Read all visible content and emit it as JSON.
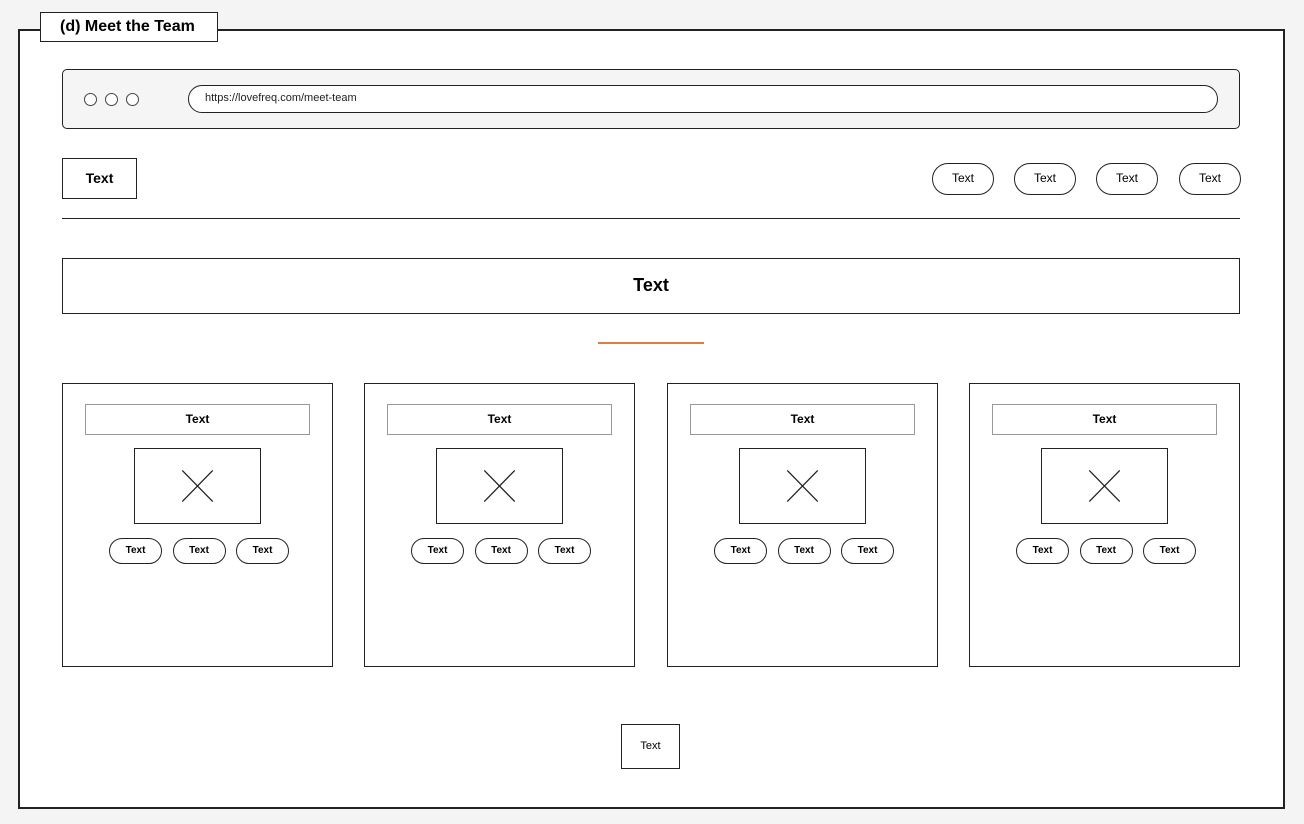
{
  "frame": {
    "label": "(d) Meet the Team"
  },
  "browser": {
    "url": "https://lovefreq.com/meet-team"
  },
  "header": {
    "logo_label": "Text",
    "nav": [
      "Text",
      "Text",
      "Text",
      "Text"
    ]
  },
  "hero": {
    "title": "Text"
  },
  "colors": {
    "accent": "#e07b43"
  },
  "cards": [
    {
      "title": "Text",
      "image_icon": "image-placeholder-icon",
      "buttons": [
        "Text",
        "Text",
        "Text"
      ]
    },
    {
      "title": "Text",
      "image_icon": "image-placeholder-icon",
      "buttons": [
        "Text",
        "Text",
        "Text"
      ]
    },
    {
      "title": "Text",
      "image_icon": "image-placeholder-icon",
      "buttons": [
        "Text",
        "Text",
        "Text"
      ]
    },
    {
      "title": "Text",
      "image_icon": "image-placeholder-icon",
      "buttons": [
        "Text",
        "Text",
        "Text"
      ]
    }
  ],
  "footer": {
    "button_label": "Text"
  }
}
